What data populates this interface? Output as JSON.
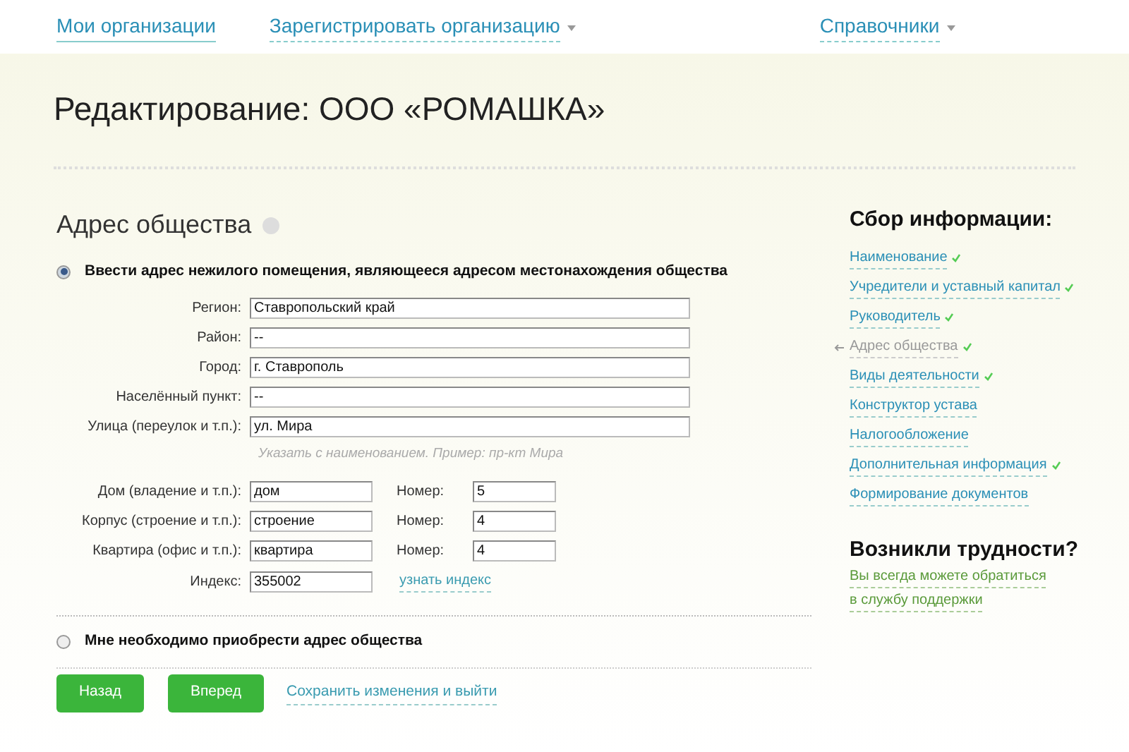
{
  "nav": [
    {
      "label": "Мои организации",
      "dropdown": false
    },
    {
      "label": "Зарегистрировать организацию",
      "dropdown": true
    },
    {
      "label": "Справочники",
      "dropdown": true
    }
  ],
  "page_title": "Редактирование: ООО «РОМАШКА»",
  "section_title": "Адрес общества",
  "options": [
    {
      "label": "Ввести адрес нежилого помещения, являющееся адресом местонахождения общества",
      "selected": true
    },
    {
      "label": "Мне необходимо приобрести адрес общества",
      "selected": false
    }
  ],
  "address_fields": [
    {
      "label": "Регион:",
      "value": "Ставропольский край"
    },
    {
      "label": "Район:",
      "value": "--"
    },
    {
      "label": "Город:",
      "value": "г. Ставрополь"
    },
    {
      "label": "Населённый пункт:",
      "value": "--"
    },
    {
      "label": "Улица (переулок и т.п.):",
      "value": "ул. Мира"
    }
  ],
  "street_hint": "Указать с наименованием. Пример: пр-кт Мира",
  "building_fields": [
    {
      "label": "Дом (владение и т.п.):",
      "value": "дом",
      "number_label": "Номер:",
      "number": "5"
    },
    {
      "label": "Корпус (строение и т.п.):",
      "value": "строение",
      "number_label": "Номер:",
      "number": "4"
    },
    {
      "label": "Квартира (офис и т.п.):",
      "value": "квартира",
      "number_label": "Номер:",
      "number": "4"
    }
  ],
  "postcode": {
    "label": "Индекс:",
    "value": "355002",
    "link": "узнать индекс"
  },
  "buttons": [
    "Назад",
    "Вперед"
  ],
  "save_link": "Сохранить изменения и выйти",
  "steps_title": "Сбор информации:",
  "steps": [
    {
      "label": "Наименование",
      "done": true,
      "selected": false
    },
    {
      "label": "Учредители и уставный капитал",
      "done": true,
      "selected": false
    },
    {
      "label": "Руководитель",
      "done": true,
      "selected": false
    },
    {
      "label": "Адрес общества",
      "done": true,
      "selected": true
    },
    {
      "label": "Виды деятельности",
      "done": true,
      "selected": false
    },
    {
      "label": "Конструктор устава",
      "done": false,
      "selected": false
    },
    {
      "label": "Налогообложение",
      "done": false,
      "selected": false
    },
    {
      "label": "Дополнительная информация",
      "done": true,
      "selected": false
    },
    {
      "label": "Формирование документов",
      "done": false,
      "selected": false
    }
  ],
  "help": {
    "title": "Возникли трудности?",
    "lines": [
      "Вы всегда можете обратиться",
      "в службу поддержки"
    ]
  }
}
